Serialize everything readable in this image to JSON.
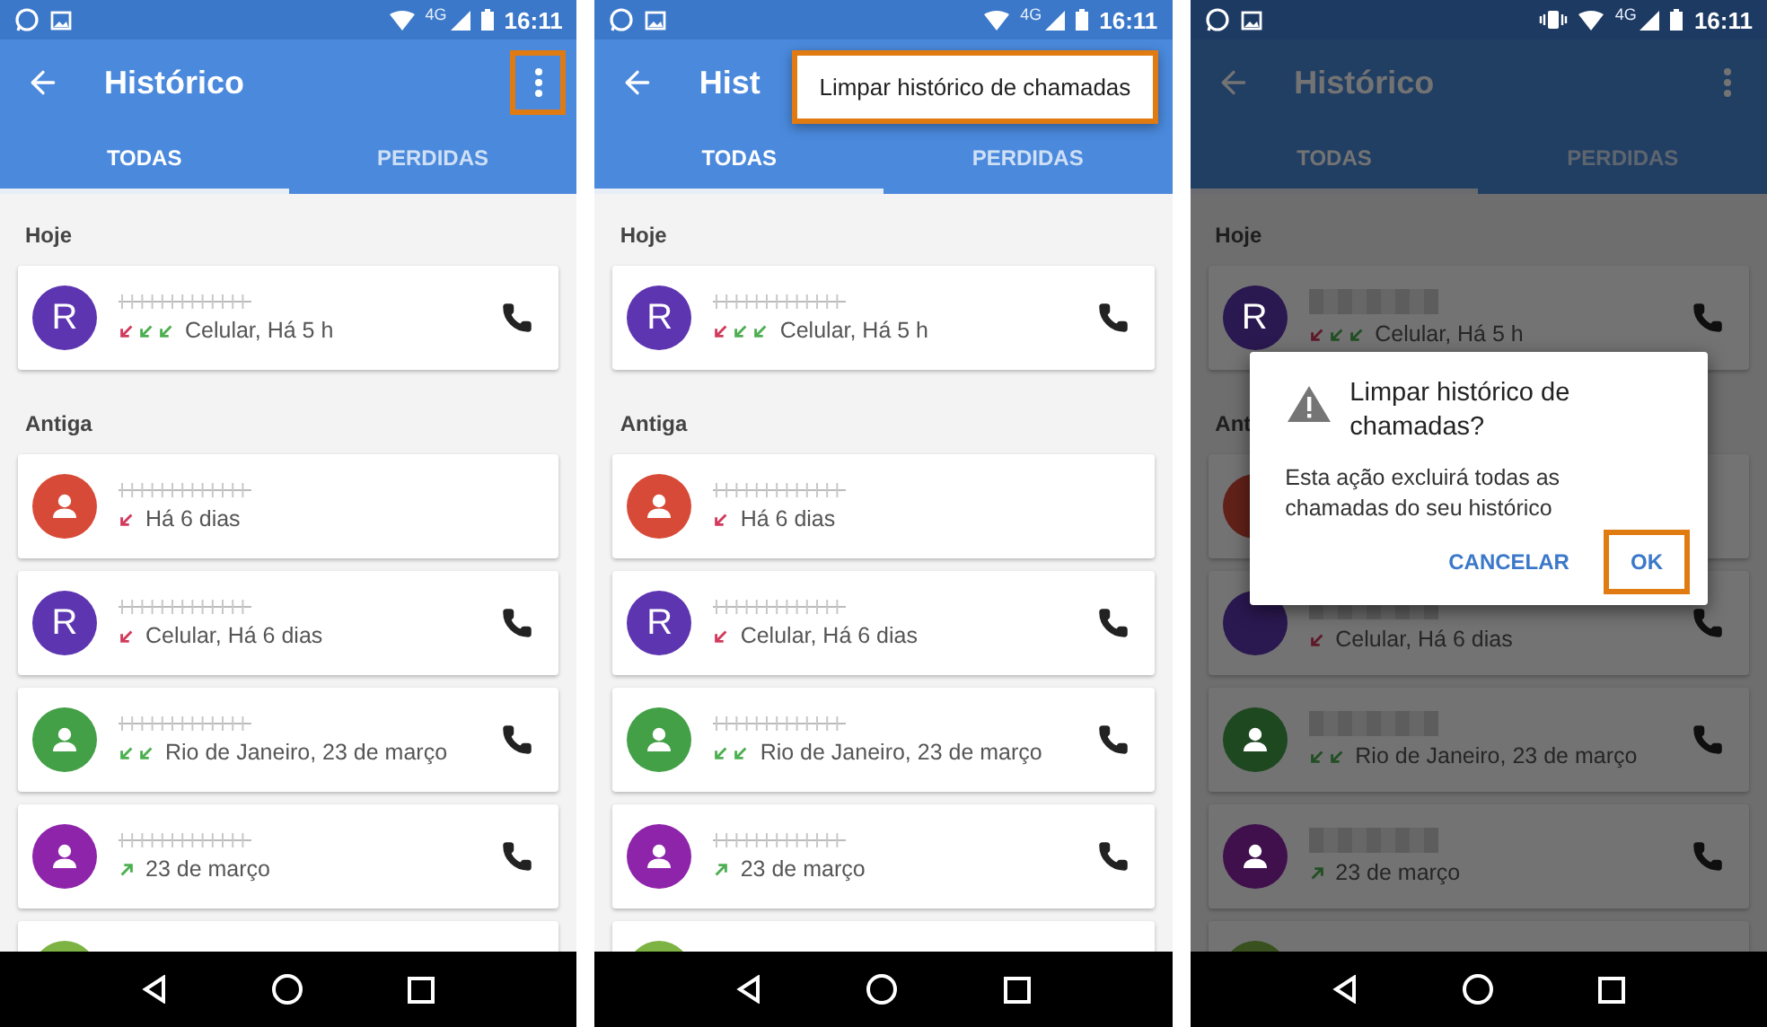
{
  "phones": [
    {
      "kind": "hatched",
      "status_bar": {
        "time": "16:11",
        "network": "4G",
        "vibrate": false
      },
      "app_bar": {
        "title": "Histórico",
        "menu_highlighted": true
      },
      "dimmed": false,
      "tabs": [
        {
          "label": "TODAS",
          "selected": true
        },
        {
          "label": "PERDIDAS",
          "selected": false
        }
      ],
      "sections": [
        {
          "title": "Hoje",
          "calls": [
            {
              "kind": "letter",
              "letter": "R",
              "color": "#5e35b1",
              "arrows": [
                {
                  "kind": "missed"
                },
                {
                  "kind": "incoming"
                },
                {
                  "kind": "incoming"
                }
              ],
              "detail": "Celular, Há 5 h",
              "phone": true
            }
          ]
        },
        {
          "title": "Antiga",
          "calls": [
            {
              "kind": "person",
              "color": "#d84a38",
              "arrows": [
                {
                  "kind": "missed"
                }
              ],
              "detail": "Há 6 dias",
              "phone": false
            },
            {
              "kind": "letter",
              "letter": "R",
              "color": "#5e35b1",
              "arrows": [
                {
                  "kind": "missed"
                }
              ],
              "detail": "Celular, Há 6 dias",
              "phone": true
            },
            {
              "kind": "person",
              "color": "#43a047",
              "arrows": [
                {
                  "kind": "incoming"
                },
                {
                  "kind": "incoming"
                }
              ],
              "detail": "Rio de Janeiro, 23 de março",
              "phone": true
            },
            {
              "kind": "person",
              "color": "#8e24aa",
              "arrows": [
                {
                  "kind": "outgoing"
                }
              ],
              "detail": "23 de março",
              "phone": true
            },
            {
              "kind": "blank",
              "color": "#7cb342"
            }
          ]
        }
      ]
    },
    {
      "kind": "hatched",
      "status_bar": {
        "time": "16:11",
        "network": "4G",
        "vibrate": false
      },
      "app_bar": {
        "title": "Hist"
      },
      "dimmed": false,
      "menu": {
        "item": "Limpar histórico de chamadas",
        "highlighted": true
      },
      "tabs": [
        {
          "label": "TODAS",
          "selected": true
        },
        {
          "label": "PERDIDAS",
          "selected": false
        }
      ],
      "sections": [
        {
          "title": "Hoje",
          "calls": [
            {
              "kind": "letter",
              "letter": "R",
              "color": "#5e35b1",
              "arrows": [
                {
                  "kind": "missed"
                },
                {
                  "kind": "incoming"
                },
                {
                  "kind": "incoming"
                }
              ],
              "detail": "Celular, Há 5 h",
              "phone": true
            }
          ]
        },
        {
          "title": "Antiga",
          "calls": [
            {
              "kind": "person",
              "color": "#d84a38",
              "arrows": [
                {
                  "kind": "missed"
                }
              ],
              "detail": "Há 6 dias",
              "phone": false
            },
            {
              "kind": "letter",
              "letter": "R",
              "color": "#5e35b1",
              "arrows": [
                {
                  "kind": "missed"
                }
              ],
              "detail": "Celular, Há 6 dias",
              "phone": true
            },
            {
              "kind": "person",
              "color": "#43a047",
              "arrows": [
                {
                  "kind": "incoming"
                },
                {
                  "kind": "incoming"
                }
              ],
              "detail": "Rio de Janeiro, 23 de março",
              "phone": true
            },
            {
              "kind": "person",
              "color": "#8e24aa",
              "arrows": [
                {
                  "kind": "outgoing"
                }
              ],
              "detail": "23 de março",
              "phone": true
            },
            {
              "kind": "blank",
              "color": "#7cb342"
            }
          ]
        }
      ]
    },
    {
      "kind": "pixelated",
      "status_bar": {
        "time": "16:11",
        "network": "4G",
        "vibrate": true
      },
      "app_bar": {
        "title": "Histórico",
        "menu_highlighted": false
      },
      "dimmed": true,
      "dialog": {
        "title": "Limpar histórico de chamadas?",
        "message": "Esta ação excluirá todas as chamadas do seu histórico",
        "buttons": [
          {
            "label": "CANCELAR",
            "highlighted": false
          },
          {
            "label": "OK",
            "highlighted": true
          }
        ]
      },
      "tabs": [
        {
          "label": "TODAS",
          "selected": true
        },
        {
          "label": "PERDIDAS",
          "selected": false
        }
      ],
      "sections": [
        {
          "title": "Hoje",
          "calls": [
            {
              "kind": "letter",
              "letter": "R",
              "color": "#2a1850",
              "arrows": [
                {
                  "kind": "missed"
                },
                {
                  "kind": "incoming"
                },
                {
                  "kind": "incoming"
                }
              ],
              "detail": "Celular, Há 5 h",
              "phone": true
            }
          ]
        },
        {
          "title": "Ant",
          "calls": [
            {
              "kind": "blank",
              "color": "#612119"
            },
            {
              "kind": "blank",
              "color": "#2a1850",
              "arrows": [
                {
                  "kind": "missed"
                }
              ],
              "detail": "Celular, Há 6 dias",
              "phone": true
            },
            {
              "kind": "person",
              "color": "#1e4820",
              "arrows": [
                {
                  "kind": "incoming"
                },
                {
                  "kind": "incoming"
                }
              ],
              "detail": "Rio de Janeiro, 23 de março",
              "phone": true
            },
            {
              "kind": "person",
              "color": "#40104d",
              "arrows": [
                {
                  "kind": "outgoing"
                }
              ],
              "detail": "23 de março",
              "phone": true
            },
            {
              "kind": "blank",
              "color": "#38511e"
            }
          ]
        }
      ]
    }
  ]
}
